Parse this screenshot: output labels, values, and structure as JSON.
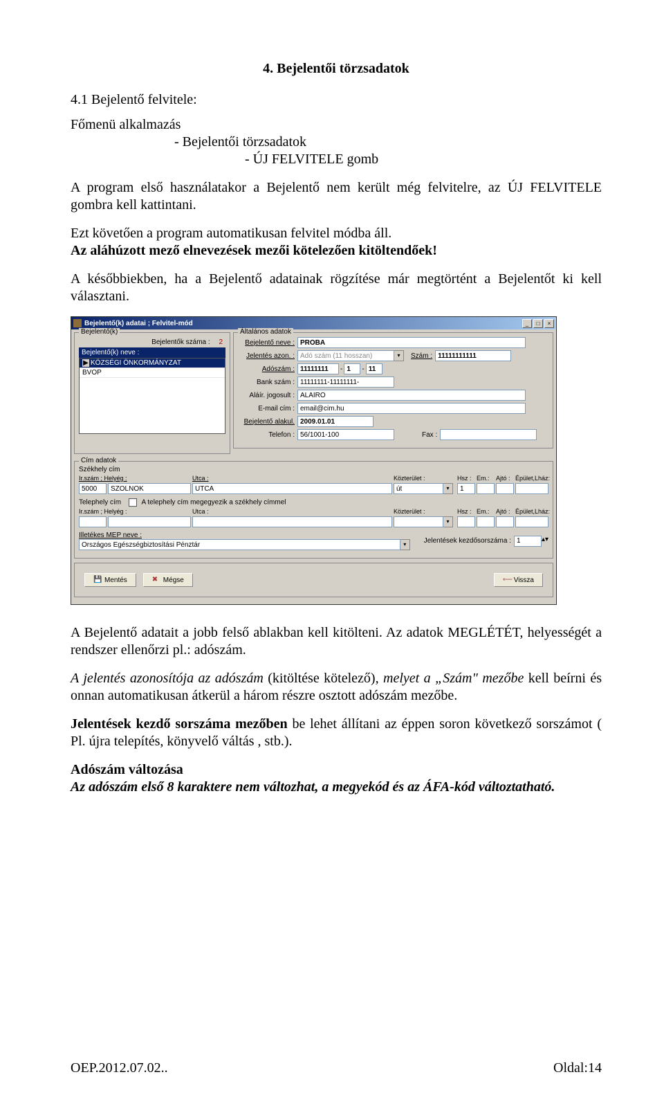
{
  "doc": {
    "section_title": "4. Bejelentői törzsadatok",
    "subsection": "4.1 Bejelentő felvitele:",
    "menu_line1": "Főmenü alkalmazás",
    "menu_line2": "- Bejelentői törzsadatok",
    "menu_line3": "- ÚJ FELVITELE gomb",
    "p1": "A program első használatakor a Bejelentő nem került még felvitelre, az ÚJ FELVITELE gombra kell kattintani.",
    "p2a": "Ezt követően a program automatikusan felvitel módba áll.",
    "p2b": "Az aláhúzott mező elnevezések mezői kötelezően kitöltendőek!",
    "p3": "A későbbiekben, ha a Bejelentő adatainak rögzítése már megtörtént a Bejelentőt ki kell választani.",
    "p4": "A Bejelentő adatait a jobb felső ablakban kell kitölteni. Az adatok MEGLÉTÉT, helyességét a rendszer ellenőrzi pl.: adószám.",
    "p5a": "A jelentés azonosítója az adószám",
    "p5b": " (kitöltése kötelező)",
    "p5c": ", melyet  a „Szám\" mezőbe",
    "p5d": " kell beírni és onnan automatikusan átkerül a három részre osztott adószám mezőbe.",
    "p6a": "Jelentések kezdő sorszáma mezőben",
    "p6b": " be lehet állítani az éppen soron következő sorszámot ( Pl. újra telepítés, könyvelő váltás , stb.).",
    "p7a": "Adószám változása",
    "p7b": "Az adószám első 8 karaktere nem változhat, a megyekód és az ÁFA-kód változtatható."
  },
  "win": {
    "title": "Bejelentő(k) adatai ; Felvitel-mód",
    "left": {
      "legend": "Bejelentő(k)",
      "count_label": "Bejelentők száma :",
      "count_value": "2",
      "list_header": "Bejelentő(k) neve :",
      "items": [
        "KÖZSÉGI ÖNKORMÁNYZAT",
        "BVOP"
      ]
    },
    "right": {
      "legend": "Általános adatok",
      "name_label": "Bejelentő neve :",
      "name_value": "PRÓBA",
      "azon_label": "Jelentés azon. :",
      "azon_value": "Adó szám (11 hosszan)",
      "szam_label": "Szám :",
      "szam_value": "11111111111",
      "ado_label": "Adószám :",
      "ado_a": "11111111",
      "ado_b": "1",
      "ado_c": "11",
      "bank_label": "Bank szám :",
      "bank_value": "11111111-11111111-",
      "alairo_label": "Aláír. jogosult :",
      "alairo_value": "ALÁÍRÓ",
      "email_label": "E-mail cím :",
      "email_value": "email@cim.hu",
      "alakul_label": "Bejelentő alakul.",
      "alakul_value": "2009.01.01",
      "tel_label": "Telefon :",
      "tel_value": "56/1001-100",
      "fax_label": "Fax :",
      "fax_value": ""
    },
    "addr": {
      "legend": "Cím adatok",
      "szekhely_label": "Székhely cím",
      "irszam_label": "Ir.szám ; Helyég :",
      "utca_label": "Utca :",
      "kozterulet_label": "Közterület :",
      "hsz_label": "Hsz :",
      "em_label": "Em.:",
      "ajto_label": "Ajtó :",
      "ep_label": "Épület,Lház:",
      "zip": "5000",
      "city": "SZOLNOK",
      "street": "UTCA",
      "street_type": "út",
      "hsz": "1",
      "telephely_label": "Telephely cím",
      "telephely_check": "A telephely cím megegyezik a székhely címmel",
      "mep_label": "Illetékes MEP neve :",
      "mep_value": "Országos Egészségbiztosítási Pénztár",
      "kezdo_label": "Jelentések kezdősorszáma :",
      "kezdo_value": "1"
    },
    "buttons": {
      "save": "Mentés",
      "cancel": "Mégse",
      "back": "Vissza"
    }
  },
  "footer": {
    "left": "OEP.2012.07.02..",
    "right": "Oldal:14"
  }
}
